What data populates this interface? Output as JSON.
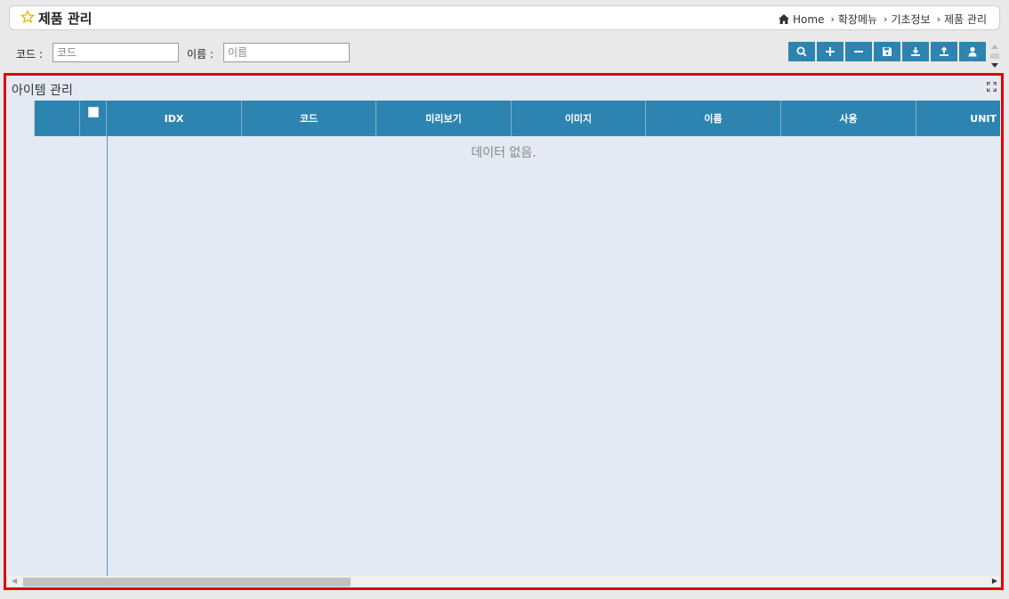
{
  "header": {
    "title": "제품 관리",
    "breadcrumb": [
      {
        "label": "Home",
        "icon": "home-icon"
      },
      {
        "label": "확장메뉴"
      },
      {
        "label": "기초정보"
      },
      {
        "label": "제품 관리"
      }
    ]
  },
  "search": {
    "code_label": "코드 :",
    "code_placeholder": "코드",
    "name_label": "이름 :",
    "name_placeholder": "이름"
  },
  "toolbar": {
    "buttons": [
      "search-icon",
      "plus-icon",
      "minus-icon",
      "save-icon",
      "download-icon",
      "upload-icon",
      "user-icon"
    ],
    "color": "#2e84b1"
  },
  "panel": {
    "title": "아이템 관리",
    "border_color": "#e00000"
  },
  "grid": {
    "columns": [
      "IDX",
      "코드",
      "미리보기",
      "이미지",
      "이름",
      "사용",
      "UNIT"
    ],
    "empty_text": "데이터 없음."
  }
}
